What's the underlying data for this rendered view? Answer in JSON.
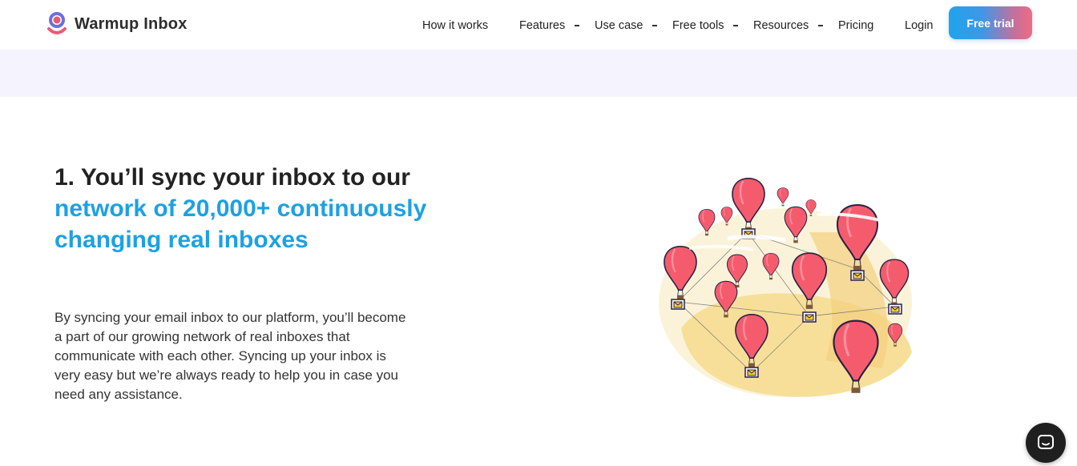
{
  "brand": {
    "name": "Warmup Inbox",
    "accent": "#1da1e3",
    "logo_color": "#ea5b72"
  },
  "nav": {
    "items": [
      {
        "label": "How it works",
        "has_dropdown": false
      },
      {
        "label": "Features",
        "has_dropdown": true
      },
      {
        "label": "Use case",
        "has_dropdown": true
      },
      {
        "label": "Free tools",
        "has_dropdown": true
      },
      {
        "label": "Resources",
        "has_dropdown": true
      },
      {
        "label": "Pricing",
        "has_dropdown": false
      }
    ],
    "login": "Login",
    "cta": "Free trial"
  },
  "section": {
    "heading_dark": "1. You’ll sync your inbox to our",
    "heading_blue": "network of 20,000+ continuously changing real inboxes",
    "body": "By syncing your email inbox to our platform, you’ll become a part of our growing network of real inboxes that communicate with each other. Syncing up your inbox is very easy but we’re always ready to help you in case you need any assistance."
  },
  "icons": {
    "logo": "warmup-inbox-logo-icon",
    "illustration": "hot-air-balloons-network-illustration",
    "chat": "chat-bubble-icon",
    "caret": "caret-down-icon"
  }
}
